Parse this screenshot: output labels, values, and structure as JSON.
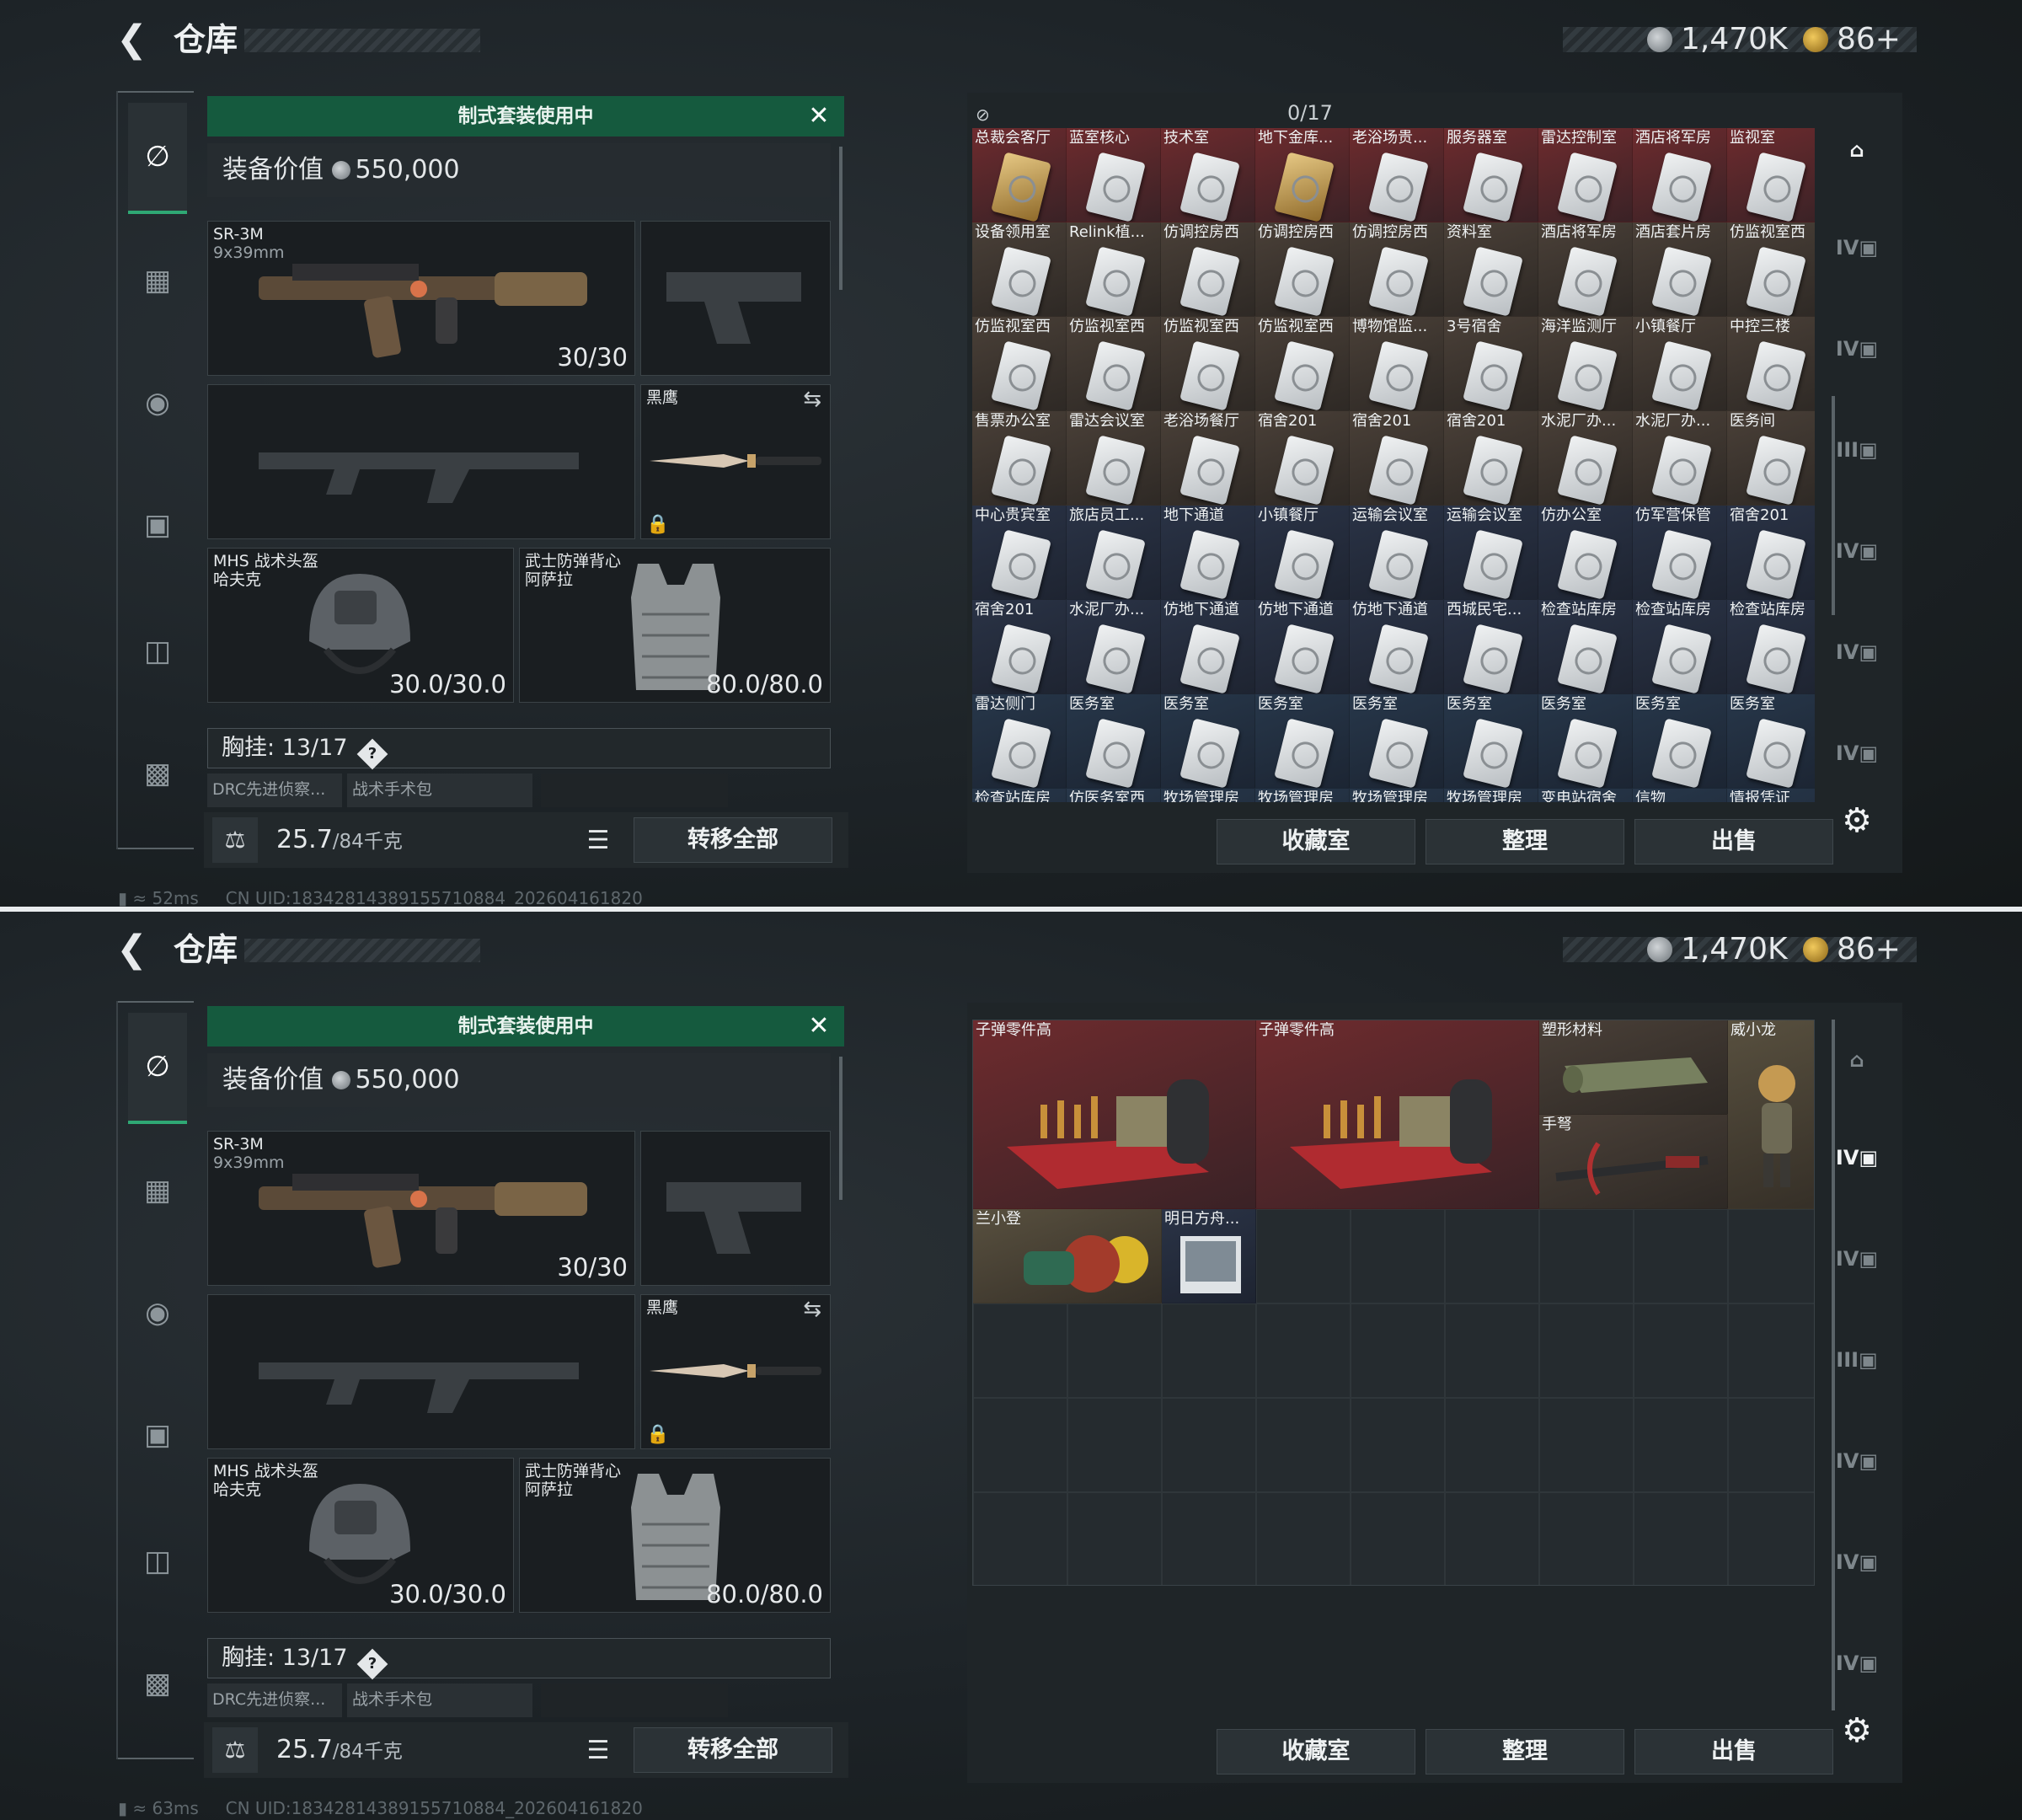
{
  "header": {
    "title": "仓库",
    "currency_silver": "1,470K",
    "currency_gold": "86+"
  },
  "loadout": {
    "banner": "制式套装使用中",
    "value_label": "装备价值",
    "value": "550,000",
    "primary": {
      "name": "SR-3M",
      "caliber": "9x39mm",
      "ammo": "30/30"
    },
    "melee": {
      "name": "黑鹰"
    },
    "helmet": {
      "name": "MHS 战术头盔",
      "sub": "哈夫克",
      "durability": "30.0/30.0"
    },
    "armor": {
      "name": "武士防弹背心",
      "sub": "阿萨拉",
      "durability": "80.0/80.0"
    },
    "chest": {
      "label": "胸挂:",
      "count": "13/17",
      "help": "?"
    },
    "pouches": [
      "DRC先进侦察...",
      "战术手术包"
    ],
    "weight": "25.7",
    "weight_max": "/84千克",
    "move_all": "转移全部"
  },
  "storage": {
    "buttons": {
      "collection": "收藏室",
      "organize": "整理",
      "sell": "出售"
    },
    "page1_count": "0/17",
    "page1_rows": [
      [
        "总裁会客厅",
        "蓝室核心",
        "技术室",
        "地下金库...",
        "老浴场贵...",
        "服务器室",
        "雷达控制室",
        "酒店将军房",
        "监视室"
      ],
      [
        "设备领用室",
        "Relink植...",
        "仿调控房西",
        "仿调控房西",
        "仿调控房西",
        "资料室",
        "酒店将军房",
        "酒店套片房",
        "仿监视室西"
      ],
      [
        "仿监视室西",
        "仿监视室西",
        "仿监视室西",
        "仿监视室西",
        "博物馆监...",
        "3号宿舍",
        "海洋监测厅",
        "小镇餐厅",
        "中控三楼"
      ],
      [
        "售票办公室",
        "雷达会议室",
        "老浴场餐厅",
        "宿舍201",
        "宿舍201",
        "宿舍201",
        "水泥厂办...",
        "水泥厂办...",
        "医务间"
      ],
      [
        "中心贵宾室",
        "旅店员工...",
        "地下通道",
        "小镇餐厅",
        "运输会议室",
        "运输会议室",
        "仿办公室",
        "仿军营保管",
        "宿舍201"
      ],
      [
        "宿舍201",
        "水泥厂办...",
        "仿地下通道",
        "仿地下通道",
        "仿地下通道",
        "西城民宅...",
        "检查站库房",
        "检查站库房",
        "检查站库房"
      ],
      [
        "雷达侧门",
        "医务室",
        "医务室",
        "医务室",
        "医务室",
        "医务室",
        "医务室",
        "医务室",
        "医务室"
      ],
      [
        "检查站库房",
        "仿医务室西",
        "牧场管理房",
        "牧场管理房",
        "牧场管理房",
        "牧场管理房",
        "变电站宿舍",
        "信物",
        "情报凭证"
      ]
    ],
    "page2_items": [
      {
        "label": "子弹零件高"
      },
      {
        "label": "子弹零件高"
      },
      {
        "label": "塑形材料"
      },
      {
        "label": "威小龙"
      },
      {
        "label": "手弩"
      },
      {
        "label": "兰小登"
      },
      {
        "label": "明日方舟..."
      }
    ],
    "tools": [
      "vault",
      "IV",
      "IV",
      "III",
      "IV",
      "IV",
      "IV",
      "settings"
    ]
  },
  "status": [
    {
      "ping": "52ms",
      "uid": "CN UID:18342814389155710884_202604161820"
    },
    {
      "ping": "63ms",
      "uid": "CN UID:18342814389155710884_202604161820"
    }
  ],
  "colors": {
    "accent_green": "#155a3e",
    "tab_green": "#2fa874"
  }
}
